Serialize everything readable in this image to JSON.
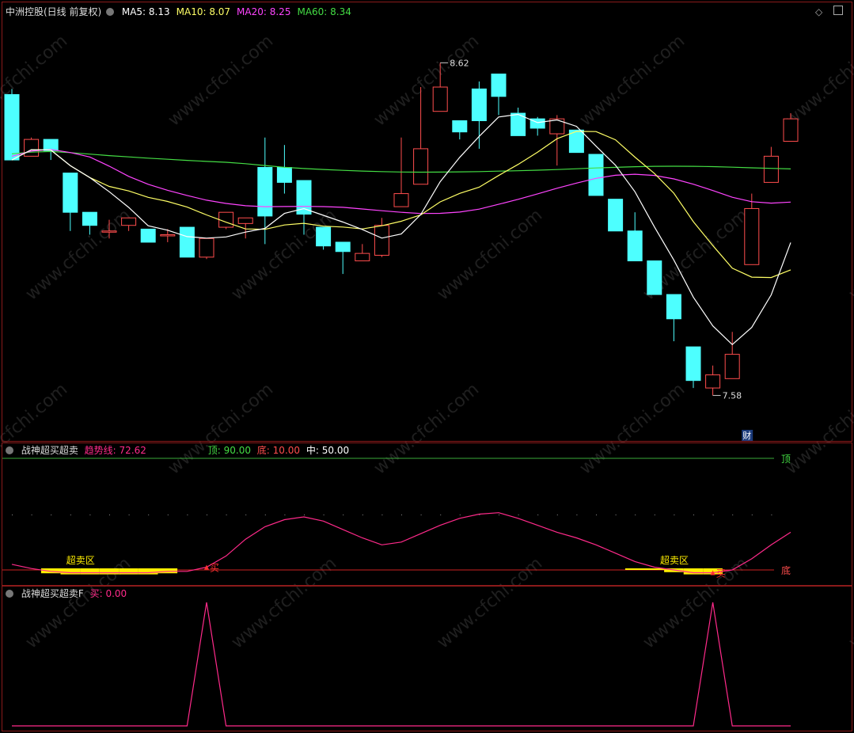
{
  "main": {
    "title": "中洲控股(日线 前复权)",
    "indicators": [
      {
        "label": "MA5:",
        "value": "8.13",
        "color": "#ffffff"
      },
      {
        "label": "MA10:",
        "value": "8.07",
        "color": "#ffff66"
      },
      {
        "label": "MA20:",
        "value": "8.25",
        "color": "#ff44ff"
      },
      {
        "label": "MA60:",
        "value": "8.34",
        "color": "#44dd44"
      }
    ],
    "high_label": "8.62",
    "low_label": "7.58",
    "badge": "财",
    "corner_icons": [
      "diamond-icon",
      "maximize-icon"
    ],
    "candles": [
      [
        8.45,
        8.1,
        8.48,
        8.1
      ],
      [
        8.12,
        8.21,
        8.22,
        8.12
      ],
      [
        8.21,
        8.15,
        8.21,
        8.1
      ],
      [
        8.03,
        7.82,
        8.03,
        7.72
      ],
      [
        7.82,
        7.75,
        7.82,
        7.7
      ],
      [
        7.72,
        7.72,
        7.78,
        7.68
      ],
      [
        7.75,
        7.79,
        7.79,
        7.72
      ],
      [
        7.73,
        7.66,
        7.73,
        7.66
      ],
      [
        7.7,
        7.7,
        7.73,
        7.66
      ],
      [
        7.74,
        7.58,
        7.74,
        7.58
      ],
      [
        7.58,
        7.68,
        7.68,
        7.57
      ],
      [
        7.74,
        7.82,
        7.82,
        7.73
      ],
      [
        7.76,
        7.79,
        7.79,
        7.68
      ],
      [
        8.06,
        7.8,
        8.22,
        7.65
      ],
      [
        8.06,
        7.98,
        8.18,
        7.92
      ],
      [
        7.99,
        7.81,
        7.99,
        7.7
      ],
      [
        7.74,
        7.64,
        7.74,
        7.62
      ],
      [
        7.66,
        7.61,
        7.66,
        7.49
      ],
      [
        7.56,
        7.6,
        7.65,
        7.56
      ],
      [
        7.59,
        7.75,
        7.79,
        7.58
      ],
      [
        7.85,
        7.92,
        8.22,
        7.87
      ],
      [
        7.97,
        8.16,
        8.49,
        7.97
      ],
      [
        8.36,
        8.49,
        8.62,
        8.36
      ],
      [
        8.31,
        8.25,
        8.31,
        8.21
      ],
      [
        8.48,
        8.31,
        8.52,
        8.16
      ],
      [
        8.56,
        8.44,
        8.56,
        8.34
      ],
      [
        8.35,
        8.23,
        8.38,
        8.23
      ],
      [
        8.32,
        8.27,
        8.33,
        8.23
      ],
      [
        8.24,
        8.32,
        8.34,
        8.07
      ],
      [
        8.26,
        8.14,
        8.26,
        8.14
      ],
      [
        8.13,
        7.91,
        8.13,
        7.91
      ],
      [
        7.89,
        7.72,
        7.89,
        7.72
      ],
      [
        7.72,
        7.56,
        7.82,
        7.56
      ],
      [
        7.56,
        7.38,
        7.56,
        7.38
      ],
      [
        7.38,
        7.25,
        7.38,
        7.13
      ],
      [
        7.1,
        6.92,
        7.1,
        6.88
      ],
      [
        6.88,
        6.95,
        7.0,
        6.84
      ],
      [
        6.93,
        7.06,
        7.18,
        6.93
      ],
      [
        7.54,
        7.84,
        7.92,
        7.54
      ],
      [
        7.98,
        8.12,
        8.17,
        7.98
      ],
      [
        8.2,
        8.32,
        8.35,
        8.2
      ]
    ]
  },
  "indicator1": {
    "name": "战神超买超卖",
    "trend_label": "趋势线:",
    "trend_value": "72.62",
    "top_label": "顶:",
    "top_value": "90.00",
    "bottom_label": "底:",
    "bottom_value": "10.00",
    "mid_label": "中:",
    "mid_value": "50.00",
    "zone_label": "超卖区",
    "buy_label": "买",
    "top_edge_label": "顶",
    "bottom_edge_label": "底",
    "trend": [
      14,
      11,
      9,
      8,
      8,
      8,
      8,
      8,
      9,
      9,
      12,
      20,
      32,
      41,
      46,
      48,
      45,
      39,
      33,
      28,
      30,
      36,
      42,
      47,
      50,
      51,
      47,
      42,
      37,
      33,
      28,
      22,
      16,
      12,
      10,
      8,
      8,
      10,
      18,
      28,
      37
    ]
  },
  "indicator2": {
    "name": "战神超买超卖F",
    "buy_label": "买:",
    "buy_value": "0.00",
    "signals": [
      0,
      0,
      0,
      0,
      0,
      0,
      0,
      0,
      0,
      0,
      1,
      0,
      0,
      0,
      0,
      0,
      0,
      0,
      0,
      0,
      0,
      0,
      0,
      0,
      0,
      0,
      0,
      0,
      0,
      0,
      0,
      0,
      0,
      0,
      0,
      0,
      1,
      0,
      0,
      0,
      0
    ]
  },
  "watermark": "www.cfchi.com",
  "colors": {
    "up": "#ff4d4d",
    "down": "#4dffff",
    "ma5": "#ffffff",
    "ma10": "#ffff66",
    "ma20": "#ff44ff",
    "ma60": "#44dd44",
    "trend": "#ff2a8a",
    "zone": "#ffee00",
    "frame": "#8b1a1a"
  }
}
